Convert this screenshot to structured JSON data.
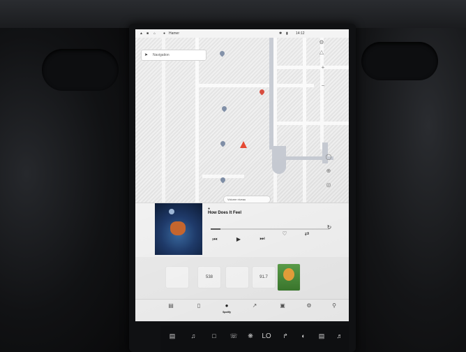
{
  "status_bar": {
    "user": "Hamer",
    "time": "14:12",
    "temperature": ""
  },
  "navigation": {
    "placeholder": "Navigation"
  },
  "map": {
    "places": [
      {
        "name": ""
      },
      {
        "name": ""
      },
      {
        "name": ""
      },
      {
        "name": ""
      },
      {
        "name": ""
      }
    ],
    "volume_label": "Volume niveau",
    "volume_value": "",
    "zoom_in": "+",
    "zoom_out": "−"
  },
  "player": {
    "title": "How Does It Feel",
    "artist": "",
    "source": "",
    "elapsed": "",
    "remaining": "",
    "progress_fraction": 0.08
  },
  "library": {
    "section_recent": "",
    "section_favorites": "",
    "tiles": [
      {
        "label": ""
      },
      {
        "label": "538"
      },
      {
        "label": ""
      },
      {
        "label": "91.7"
      },
      {
        "label": ""
      }
    ],
    "captions": [
      "",
      "",
      "",
      "",
      ""
    ]
  },
  "tabs": [
    {
      "label": "",
      "icon": "radio-icon"
    },
    {
      "label": "",
      "icon": "phone-icon"
    },
    {
      "label": "Spotify",
      "icon": "spotify-icon"
    },
    {
      "label": "",
      "icon": "contacts-icon"
    },
    {
      "label": "",
      "icon": "tunein-icon"
    },
    {
      "label": "",
      "icon": "settings-icon"
    },
    {
      "label": "",
      "icon": "search-icon"
    }
  ],
  "dock": {
    "climate_level": "LO",
    "label": ""
  },
  "colors": {
    "accent": "#e54a33",
    "pin": "#7f8ea6",
    "screen_bg": "#e9e9e8"
  }
}
